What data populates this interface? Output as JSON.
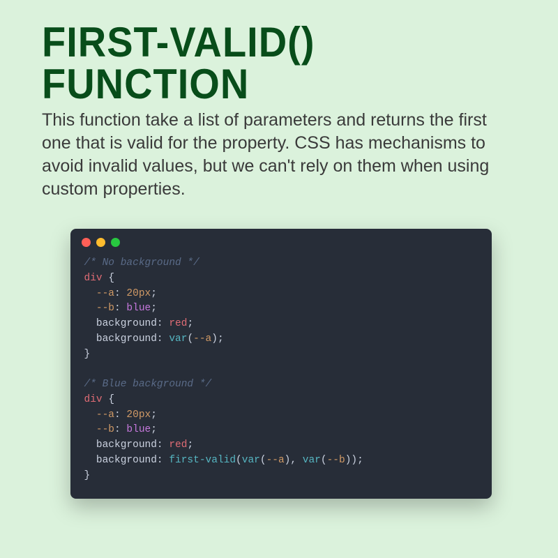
{
  "title": "FIRST-VALID() FUNCTION",
  "description": "This function take a list of parameters and returns the first one that is valid for the property. CSS has mechanisms to avoid invalid values, but we can't rely on them when using custom properties.",
  "code": {
    "block1": {
      "comment": "/* No background */",
      "selector": "div",
      "brace_open": "{",
      "a_prop": "--a",
      "a_val": "20px",
      "b_prop": "--b",
      "b_val": "blue",
      "bg1_prop": "background",
      "bg1_val": "red",
      "bg2_prop": "background",
      "bg2_func": "var",
      "bg2_arg": "--a",
      "brace_close": "}"
    },
    "block2": {
      "comment": "/* Blue background */",
      "selector": "div",
      "brace_open": "{",
      "a_prop": "--a",
      "a_val": "20px",
      "b_prop": "--b",
      "b_val": "blue",
      "bg1_prop": "background",
      "bg1_val": "red",
      "bg2_prop": "background",
      "bg2_func": "first-valid",
      "bg2_inner1": "var",
      "bg2_arg1": "--a",
      "bg2_inner2": "var",
      "bg2_arg2": "--b",
      "brace_close": "}"
    },
    "colon": ":",
    "semicolon": ";",
    "paren_open": "(",
    "paren_close": ")",
    "comma": ", "
  }
}
